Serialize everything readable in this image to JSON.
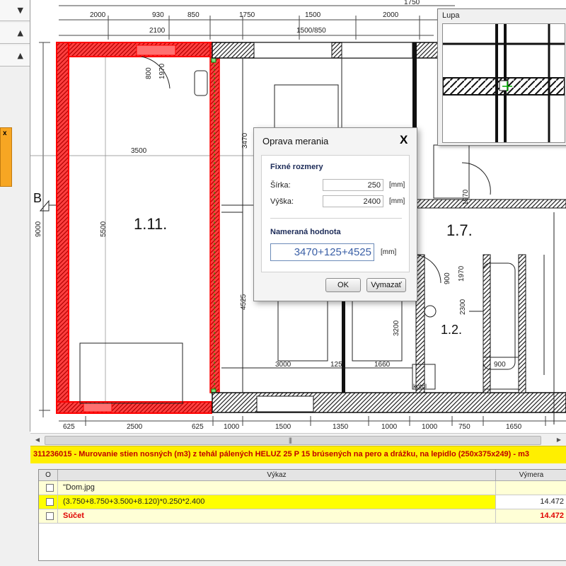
{
  "left_panel": {
    "rows": [
      "▼",
      "▲",
      "▲"
    ],
    "close_glyph": "x"
  },
  "drawing": {
    "top_dims": [
      "2000",
      "930",
      "850",
      "1750",
      "1500",
      "2000",
      "1750"
    ],
    "top_dims2": [
      "2100",
      "1500/850"
    ],
    "bottom_dims": [
      "625",
      "2500",
      "625",
      "1000",
      "1500",
      "1350",
      "1000",
      "1000",
      "750",
      "1650"
    ],
    "inner_dims": [
      "3500",
      "3000",
      "125",
      "1660",
      "900",
      "1970",
      "900",
      "3200",
      "2300",
      "1970"
    ],
    "vertical_dims": [
      "9000",
      "5500",
      "4525",
      "3470"
    ],
    "door_dims": [
      "800",
      "1970"
    ],
    "rooms": [
      "1.11.",
      "1.7.",
      "1.2."
    ],
    "section_label": "B",
    "kotol_label": "kotol"
  },
  "scrollbar": {
    "left_glyph": "◀",
    "right_glyph": "▶",
    "grip": "|||"
  },
  "description": "311236015 - Murovanie stien nosných (m3) z tehál pálených HELUZ 25 P 15 brúsených na pero a drážku, na lepidlo (250x375x249) - m3",
  "grid": {
    "headers": [
      "O",
      "Výkaz",
      "Výmera"
    ],
    "rows": [
      {
        "text": "\"Dom.jpg",
        "value": ""
      },
      {
        "text": "(3.750+8.750+3.500+8.120)*0.250*2.400",
        "value": "14.472"
      },
      {
        "text": "Súčet",
        "value": "14.472"
      }
    ]
  },
  "lupa": {
    "title": "Lupa"
  },
  "dialog": {
    "title": "Oprava merania",
    "close": "X",
    "fixed_section": "Fixné rozmery",
    "width_label": "Šírka:",
    "width_value": "250",
    "height_label": "Výška:",
    "height_value": "2400",
    "unit": "[mm]",
    "measured_section": "Nameraná hodnota",
    "measured_value": "3470+125+4525",
    "ok": "OK",
    "clear": "Vymazať"
  },
  "colors": {
    "highlight_red": "#ff0000",
    "description_bar": "#ffef00",
    "sum_text": "#e00000",
    "row_highlight": "#ffff00"
  }
}
